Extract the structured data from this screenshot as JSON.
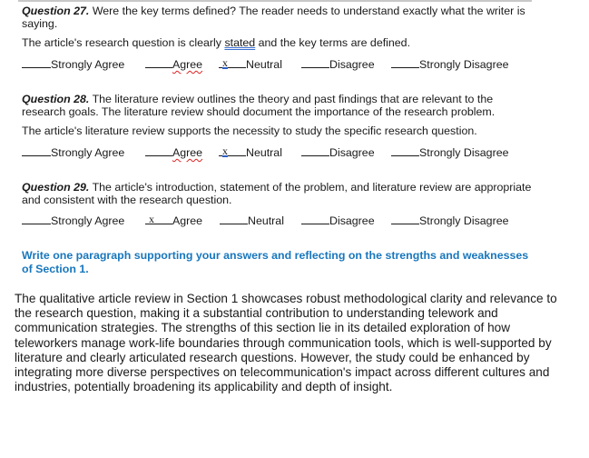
{
  "questions": [
    {
      "label": "Question 27.",
      "text": " Were the key terms defined? The reader needs to understand exactly what the writer is saying.",
      "statement_before": "The article's research question is clearly ",
      "statement_flagged": "stated",
      "statement_after": " and the key terms are defined.",
      "selected": "Neutral",
      "options": [
        {
          "label": "Strongly Agree",
          "mark": ""
        },
        {
          "label": "Agree",
          "mark": ""
        },
        {
          "label": "Neutral",
          "mark": "x"
        },
        {
          "label": "Disagree",
          "mark": ""
        },
        {
          "label": "Strongly Disagree",
          "mark": ""
        }
      ]
    },
    {
      "label": "Question 28.",
      "text": " The literature review outlines the theory and past findings that are relevant to the research goals. The literature review should document the importance of the research problem.",
      "statement": "The article's literature review supports the necessity to study the specific research question.",
      "selected": "Neutral",
      "options": [
        {
          "label": "Strongly Agree",
          "mark": ""
        },
        {
          "label": "Agree",
          "mark": ""
        },
        {
          "label": "Neutral",
          "mark": "x"
        },
        {
          "label": "Disagree",
          "mark": ""
        },
        {
          "label": "Strongly Disagree",
          "mark": ""
        }
      ]
    },
    {
      "label": "Question 29.",
      "text": " The article's introduction, statement of the problem, and literature review are appropriate and consistent with the research question.",
      "selected": "Agree",
      "options": [
        {
          "label": "Strongly Agree",
          "mark": ""
        },
        {
          "label": "Agree",
          "mark": "x"
        },
        {
          "label": "Neutral",
          "mark": ""
        },
        {
          "label": "Disagree",
          "mark": ""
        },
        {
          "label": "Strongly Disagree",
          "mark": ""
        }
      ]
    }
  ],
  "prompt": "Write one paragraph supporting your answers and reflecting on the strengths and weaknesses of Section 1.",
  "answer": "The qualitative article review in Section 1 showcases robust methodological clarity and relevance to the research question, making it a substantial contribution to understanding telework and communication strategies. The strengths of this section lie in its detailed exploration of how teleworkers manage work-life boundaries through communication tools, which is well-supported by literature and clearly articulated research questions. However, the study could be enhanced by integrating more diverse perspectives on telecommunication's impact across different cultures and industries, potentially broadening its applicability and depth of insight.",
  "colors": {
    "prompt": "#1877bd",
    "text": "#1a1a1a",
    "spellcheck_red": "#dd2222",
    "grammar_blue": "#3a6fd0"
  }
}
